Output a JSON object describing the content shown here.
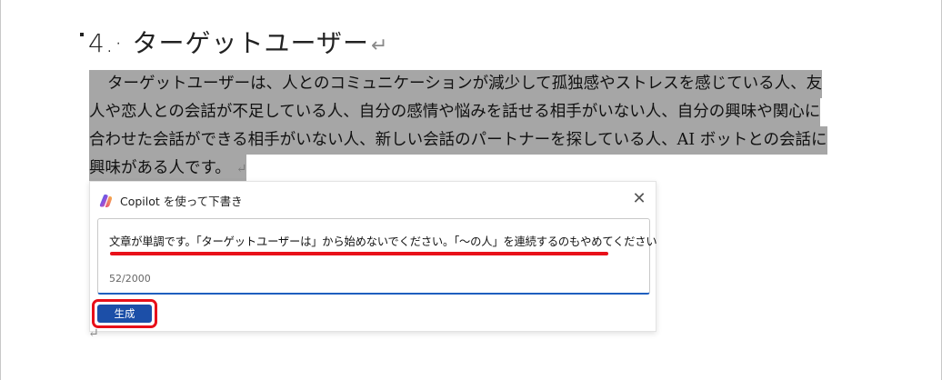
{
  "document": {
    "heading": "4.· ターゲットユーザー",
    "paragraph_mark": "↵",
    "paragraph_lines": [
      "ターゲットユーザーは、人とのコミュニケーションが減少して孤独感やストレスを感じている人、友",
      "人や恋人との会話が不足している人、自分の感情や悩みを話せる相手がいない人、自分の興味や関心に",
      "合わせた会話ができる相手がいない人、新しい会話のパートナーを探している人、AI ボットとの会話に",
      "興味がある人です。"
    ],
    "highlight_color": "#a6a6a6"
  },
  "copilot": {
    "title": "Copilot を使って下書き",
    "close_label": "✕",
    "prompt_text": "文章が単調です。「ターゲットユーザーは」から始めないでください。「～の人」を連続するのもやめてください",
    "char_count": "52/2000",
    "generate_label": "生成",
    "accent_color": "#1c4fa8",
    "annotation_color": "#e8101a"
  }
}
